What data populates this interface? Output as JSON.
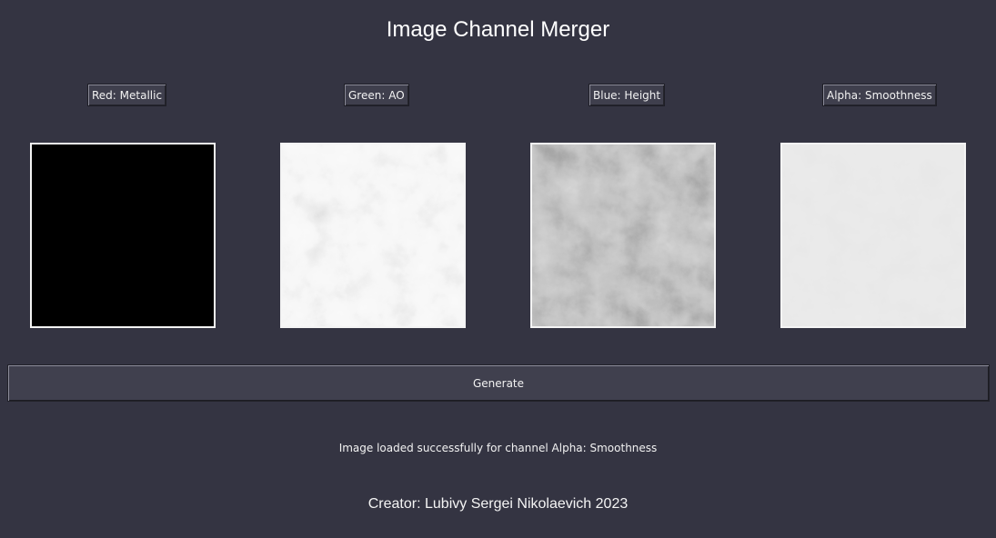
{
  "app": {
    "title": "Image Channel Merger"
  },
  "channels": [
    {
      "id": "red",
      "label": "Red: Metallic",
      "preview": "black-texture"
    },
    {
      "id": "green",
      "label": "Green: AO",
      "preview": "light-grey-noise-texture"
    },
    {
      "id": "blue",
      "label": "Blue: Height",
      "preview": "grey-rocky-height-texture"
    },
    {
      "id": "alpha",
      "label": "Alpha: Smoothness",
      "preview": "flat-light-grey-texture"
    }
  ],
  "actions": {
    "generate_label": "Generate"
  },
  "status": {
    "message": "Image loaded successfully for channel Alpha: Smoothness"
  },
  "footer": {
    "creator": "Creator: Lubivy Sergei Nikolaevich 2023"
  },
  "colors": {
    "background": "#343442",
    "button": "#3f3f4d",
    "text": "#ffffff",
    "preview_border": "#f4f4f4"
  }
}
